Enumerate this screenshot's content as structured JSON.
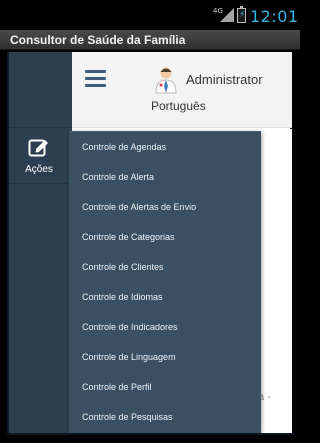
{
  "status_bar": {
    "network": "4G",
    "time": "12:01",
    "accent_color": "#33b5e5"
  },
  "window": {
    "title": "Consultor de Saúde da Família"
  },
  "header": {
    "menu_icon": "hamburger-icon",
    "user": "Administrator",
    "language": "Português"
  },
  "sidebar": {
    "action_icon": "edit-icon",
    "action_label": "Ações"
  },
  "menu": {
    "items": [
      "Controle de Agendas",
      "Controle de Alerta",
      "Controle de Alertas de Envio",
      "Controle de Categorias",
      "Controle de Clientes",
      "Controle de Idiomas",
      "Controle de Indicadores",
      "Controle de Linguagem",
      "Controle de Perfil",
      "Controle de Pesquisas"
    ]
  },
  "content": {
    "partial_text": "a -"
  },
  "colors": {
    "sidebar": "#2d3e50",
    "menu": "#3b4f62",
    "header": "#f3f3f3",
    "hamburger": "#3e5c7c"
  }
}
